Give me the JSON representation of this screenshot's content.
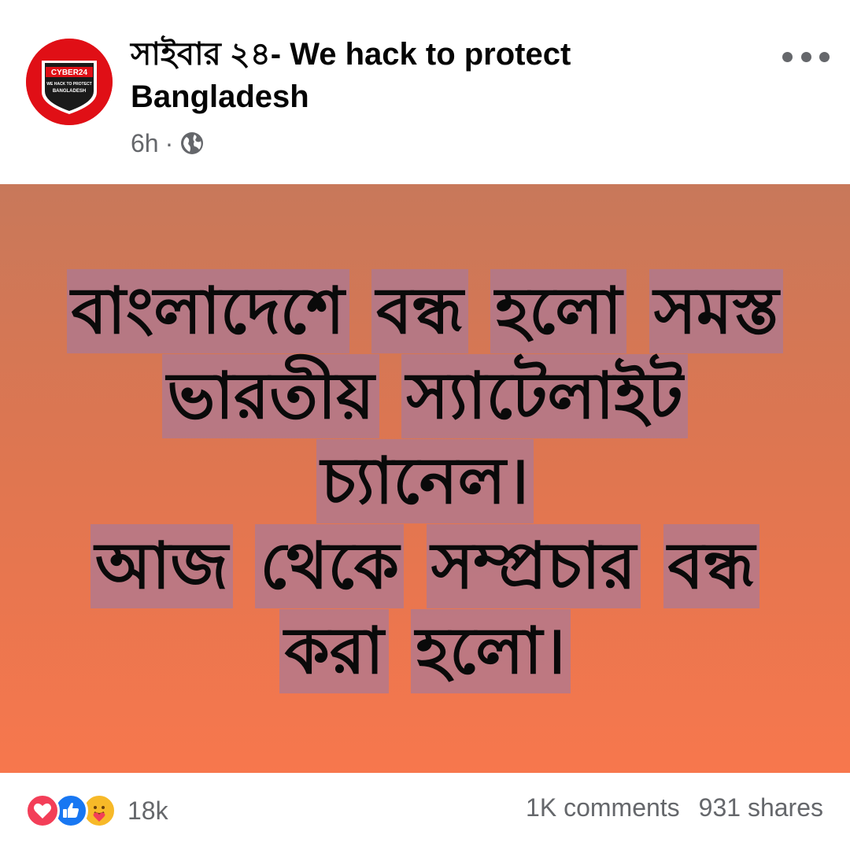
{
  "post": {
    "page_name": "সাইবার ২৪- We hack to protect Bangladesh",
    "time": "6h",
    "separator": "·",
    "privacy_icon": "globe-icon",
    "more_icon": "more-options-icon",
    "avatar": {
      "logo_text": "CYBER24",
      "logo_subtext_1": "WE HACK TO PROTECT",
      "logo_subtext_2": "BANGLADESH",
      "background_color": "#e00f16"
    }
  },
  "image": {
    "lines": [
      [
        "বাংলাদেশে",
        "বন্ধ",
        "হলো",
        "সমস্ত"
      ],
      [
        "ভারতীয়",
        "স্যাটেলাইট"
      ],
      [
        "চ্যানেল।"
      ],
      [
        "আজ",
        "থেকে",
        "সম্প্রচার",
        "বন্ধ"
      ],
      [
        "করা",
        "হলো।"
      ]
    ],
    "gradient_top": "#c8785a",
    "gradient_bottom": "#f7774d"
  },
  "footer": {
    "reaction_icons": [
      "love-icon",
      "like-icon",
      "care-icon"
    ],
    "reaction_count": "18k",
    "comments": "1K comments",
    "shares": "931 shares"
  }
}
